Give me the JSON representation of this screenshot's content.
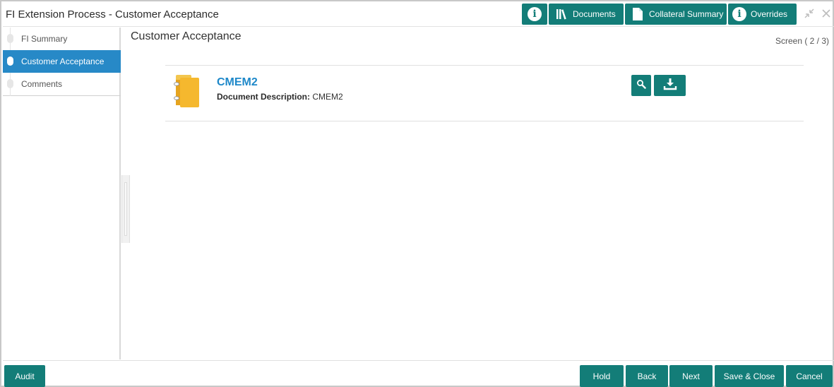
{
  "header": {
    "title": "FI Extension Process - Customer Acceptance",
    "buttons": {
      "info": "",
      "documents": "Documents",
      "collateral_summary": "Collateral Summary",
      "overrides": "Overrides"
    },
    "icons": [
      "info-icon",
      "library-icon",
      "document-icon",
      "info-icon",
      "minimize-icon",
      "close-icon"
    ]
  },
  "sidebar": {
    "items": [
      {
        "label": "FI Summary",
        "active": false
      },
      {
        "label": "Customer Acceptance",
        "active": true
      },
      {
        "label": "Comments",
        "active": false
      }
    ]
  },
  "main": {
    "title": "Customer Acceptance",
    "screen_indicator": "Screen ( 2 / 3)",
    "document": {
      "name": "CMEM2",
      "description_label": "Document Description:",
      "description_value": "CMEM2",
      "actions": [
        "search-icon",
        "download-icon"
      ]
    }
  },
  "footer": {
    "audit": "Audit",
    "hold": "Hold",
    "back": "Back",
    "next": "Next",
    "save_close": "Save & Close",
    "cancel": "Cancel"
  },
  "colors": {
    "accent": "#137d78",
    "active_nav": "#2789c7",
    "doc_link": "#1e88c9",
    "doc_icon": "#f5b82e"
  }
}
